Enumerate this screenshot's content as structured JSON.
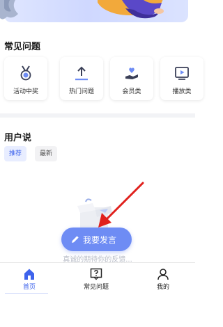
{
  "faq": {
    "title": "常见问题",
    "items": [
      {
        "label": "活动中奖",
        "icon": "medal-icon"
      },
      {
        "label": "热门问题",
        "icon": "upload-arrow-icon"
      },
      {
        "label": "会员类",
        "icon": "hand-heart-icon"
      },
      {
        "label": "播放类",
        "icon": "play-screen-icon"
      }
    ]
  },
  "user_say": {
    "title": "用户说",
    "filters": [
      "推荐",
      "最新"
    ],
    "active_filter": "推荐",
    "empty_text": "真诚的期待你的反馈..."
  },
  "post_button": {
    "label": "我要发言",
    "icon": "pencil-icon"
  },
  "tabbar": {
    "items": [
      {
        "label": "首页",
        "icon": "home-icon",
        "active": true
      },
      {
        "label": "常见问题",
        "icon": "question-box-icon",
        "active": false
      },
      {
        "label": "我的",
        "icon": "person-icon",
        "active": false
      }
    ]
  },
  "colors": {
    "accent": "#3e63ec",
    "button": "#6e8cf4",
    "annotation_arrow": "#e0201c"
  }
}
